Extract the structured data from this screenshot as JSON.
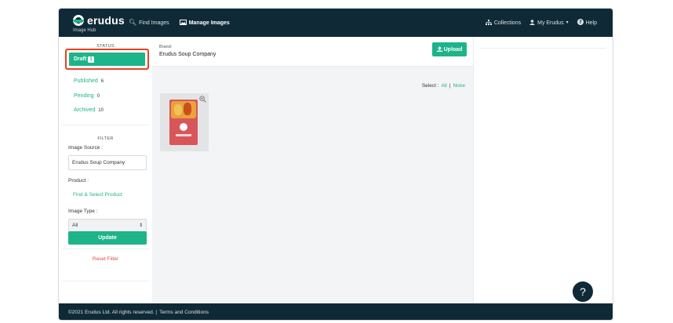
{
  "nav": {
    "logo_text": "erudus",
    "logo_sub": "Image Hub",
    "find_images": "Find Images",
    "manage_images": "Manage Images",
    "collections": "Collections",
    "my_erudus": "My Erudus",
    "help": "Help"
  },
  "sidebar": {
    "status_title": "STATUS",
    "draft_label": "Draft",
    "draft_count": "1",
    "published_label": "Published",
    "published_count": "6",
    "pending_label": "Pending",
    "pending_count": "0",
    "archived_label": "Archived",
    "archived_count": "10",
    "filter_title": "FILTER",
    "image_source_label": "Image Source :",
    "image_source_value": "Erudus Soup Company",
    "product_label": "Product :",
    "find_select_product": "Find & Select Product",
    "image_type_label": "Image Type :",
    "image_type_value": "All",
    "update_label": "Update",
    "reset_label": "Reset Filter"
  },
  "main": {
    "brand_label": "Brand:",
    "brand_name": "Erudus Soup Company",
    "upload_label": "Upload",
    "select_label": "Select :",
    "select_all": "All",
    "select_sep": "|",
    "select_none": "None"
  },
  "footer": {
    "copyright": "©2021 Erudus Ltd. All rights reserved. |",
    "terms": "Terms and Conditions"
  },
  "help_fab": "?",
  "colors": {
    "nav_bg": "#0f2a36",
    "accent": "#1db48a",
    "highlight_outline": "#e8431c",
    "reset_red": "#e04a4a"
  }
}
